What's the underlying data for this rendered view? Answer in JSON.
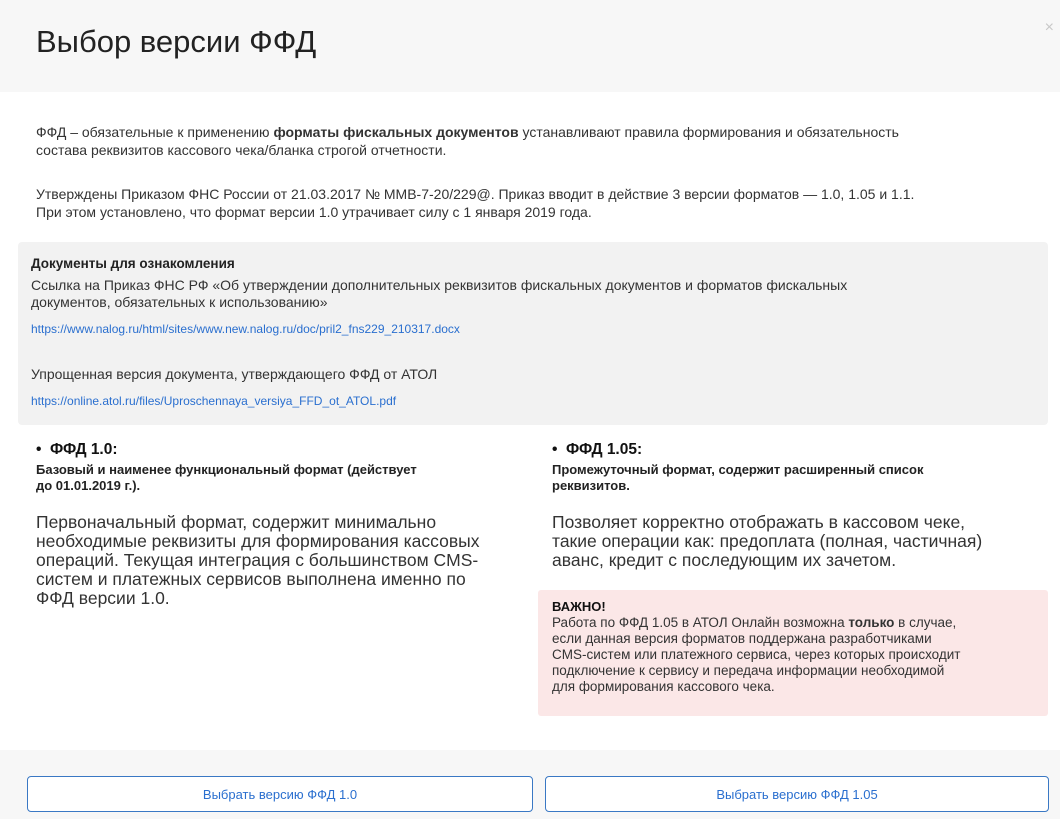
{
  "dialog": {
    "title": "Выбор версии ФФД",
    "close": "×"
  },
  "intro": {
    "p1_start": "ФФД – обязательные к применению ",
    "p1_bold": "форматы фискальных документов",
    "p1_end": " устанавливают правила формирования и обязательность",
    "p1_line2": "состава реквизитов кассового чека/бланка строгой отчетности.",
    "p2_line1": "Утверждены Приказом ФНС России от 21.03.2017 № ММВ-7-20/229@. Приказ вводит в действие 3 версии форматов — 1.0, 1.05 и 1.1.",
    "p2_line2": "При этом установлено, что формат версии 1.0 утрачивает силу с 1 января 2019 года."
  },
  "docs": {
    "title": "Документы для ознакомления",
    "doc1_line1": "Ссылка на Приказ ФНС РФ «Об утверждении дополнительных реквизитов фискальных документов и форматов фискальных",
    "doc1_line2": "документов, обязательных к использованию»",
    "doc1_link": "https://www.nalog.ru/html/sites/www.new.nalog.ru/doc/pril2_fns229_210317.docx",
    "doc2_text": "Упрощенная версия документа, утверждающего ФФД от АТОЛ",
    "doc2_link": "https://online.atol.ru/files/Uproschennaya_versiya_FFD_ot_ATOL.pdf"
  },
  "ffd10": {
    "bullet": "•",
    "title": "ФФД 1.0:",
    "subtitle_line1": "Базовый и наименее функциональный формат (действует",
    "subtitle_line2": "до 01.01.2019 г.).",
    "desc_line1": "Первоначальный формат, содержит минимально",
    "desc_line2": "необходимые реквизиты для формирования кассовых",
    "desc_line3": "операций. Текущая интеграция с большинством CMS-",
    "desc_line4": "систем и платежных сервисов выполнена именно по",
    "desc_line5": "ФФД версии 1.0."
  },
  "ffd105": {
    "bullet": "•",
    "title": "ФФД 1.05:",
    "subtitle_line1": "Промежуточный формат, содержит расширенный список",
    "subtitle_line2": "реквизитов.",
    "desc_line1": "Позволяет корректно отображать в кассовом чеке,",
    "desc_line2": "такие операции как: предоплата (полная, частичная)",
    "desc_line3": "аванс, кредит с последующим их зачетом."
  },
  "warning": {
    "title": "ВАЖНО!",
    "line1_start": "Работа по ФФД 1.05 в АТОЛ Онлайн возможна ",
    "line1_bold": "только",
    "line1_end": " в случае,",
    "line2": "если данная версия форматов поддержана разработчиками",
    "line3": "CMS-систем или платежного сервиса, через которых происходит",
    "line4": "подключение к сервису и передача информации необходимой",
    "line5": "для формирования кассового чека."
  },
  "buttons": {
    "select10": "Выбрать версию ФФД 1.0",
    "select105": "Выбрать версию ФФД 1.05"
  }
}
